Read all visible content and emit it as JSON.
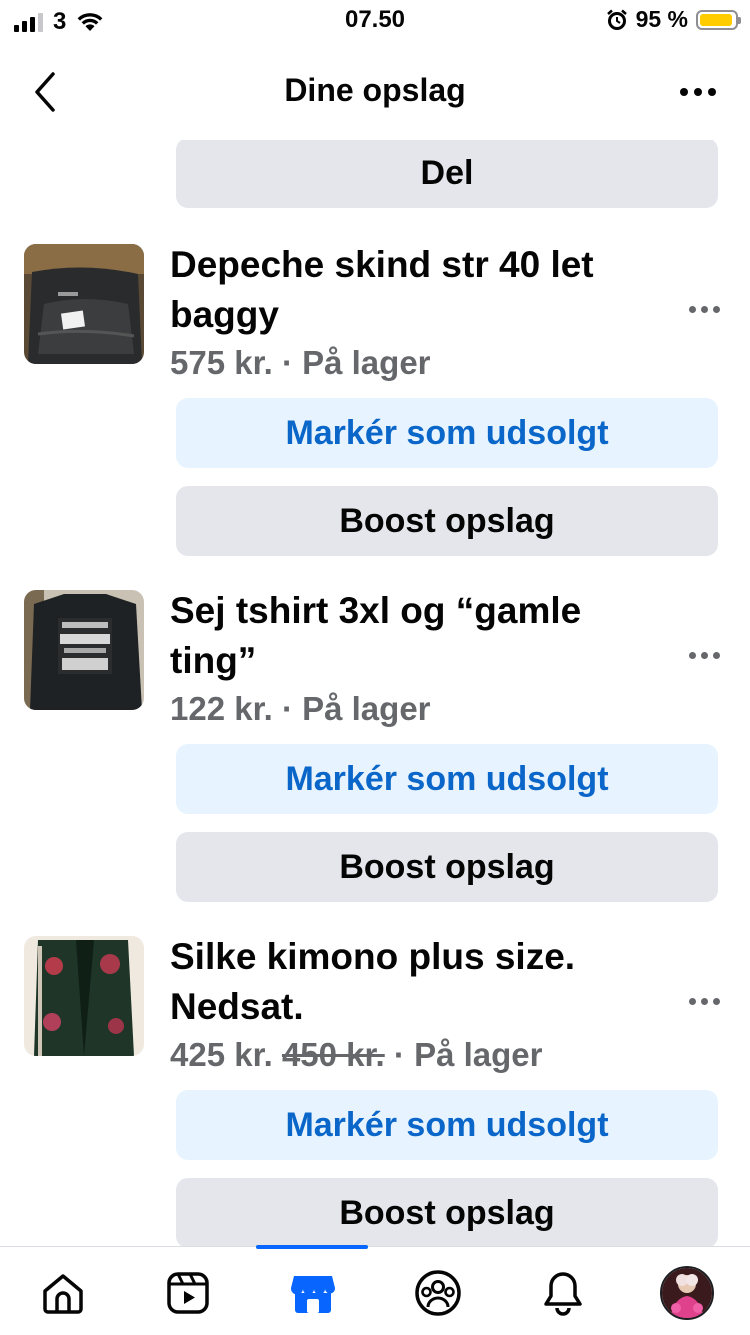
{
  "status_bar": {
    "carrier": "3",
    "time": "07.50",
    "battery_percent": "95 %",
    "battery_level": 0.95,
    "battery_color": "#ffcc00"
  },
  "header": {
    "title": "Dine opslag",
    "back_icon": "chevron-left-icon",
    "more_icon": "more-horizontal-icon"
  },
  "share_button": {
    "label": "Del"
  },
  "listings": [
    {
      "title": "Depeche skind str 40 let baggy",
      "price": "575 kr.",
      "old_price": "",
      "status": "· På lager",
      "mark_sold_label": "Markér som udsolgt",
      "boost_label": "Boost opslag"
    },
    {
      "title": "Sej tshirt 3xl og “gamle ting”",
      "price": "122 kr.",
      "old_price": "",
      "status": "· På lager",
      "mark_sold_label": "Markér som udsolgt",
      "boost_label": "Boost opslag"
    },
    {
      "title": "Silke kimono plus size. Nedsat.",
      "price": "425 kr.",
      "old_price": "450 kr.",
      "status": "· På lager",
      "mark_sold_label": "Markér som udsolgt",
      "boost_label": "Boost opslag"
    }
  ],
  "bottom_nav": {
    "items": [
      "home-icon",
      "video-icon",
      "marketplace-icon",
      "groups-icon",
      "bell-icon",
      "profile-avatar"
    ],
    "active": "marketplace-icon",
    "accent_color": "#0866ff"
  }
}
